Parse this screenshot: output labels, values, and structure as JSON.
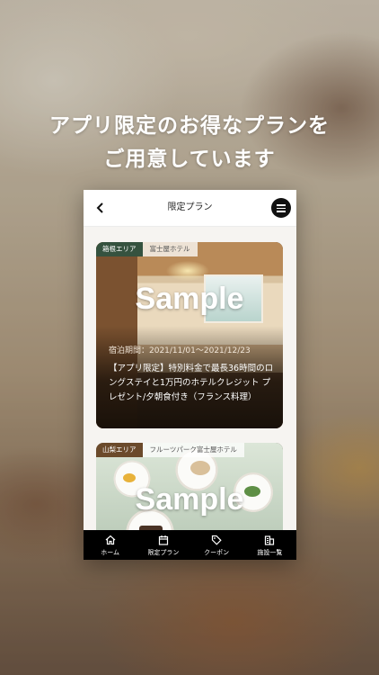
{
  "headline": {
    "line1": "アプリ限定のお得なプランを",
    "line2": "ご用意しています"
  },
  "navbar": {
    "title": "限定プラン",
    "back_icon": "chevron-left-icon",
    "menu_icon": "hamburger-menu-icon"
  },
  "cards": [
    {
      "area": "箱根エリア",
      "hotel": "富士屋ホテル",
      "image_overlay": "Sample",
      "period": "宿泊期間：2021/11/01～2021/12/23",
      "description": "【アプリ限定】特別料金で最長36時間のロングステイと1万円のホテルクレジット プレゼント/夕朝食付き（フランス料理）"
    },
    {
      "area": "山梨エリア",
      "hotel": "フルーツパーク富士屋ホテル",
      "image_overlay": "Sample"
    }
  ],
  "tabbar": [
    {
      "label": "ホーム",
      "icon": "home-icon"
    },
    {
      "label": "限定プラン",
      "icon": "calendar-icon"
    },
    {
      "label": "クーポン",
      "icon": "tag-icon"
    },
    {
      "label": "施設一覧",
      "icon": "building-icon"
    }
  ],
  "colors": {
    "area_tag": "#35523f",
    "tabbar_bg": "#000000",
    "headline_text": "#ffffff"
  }
}
